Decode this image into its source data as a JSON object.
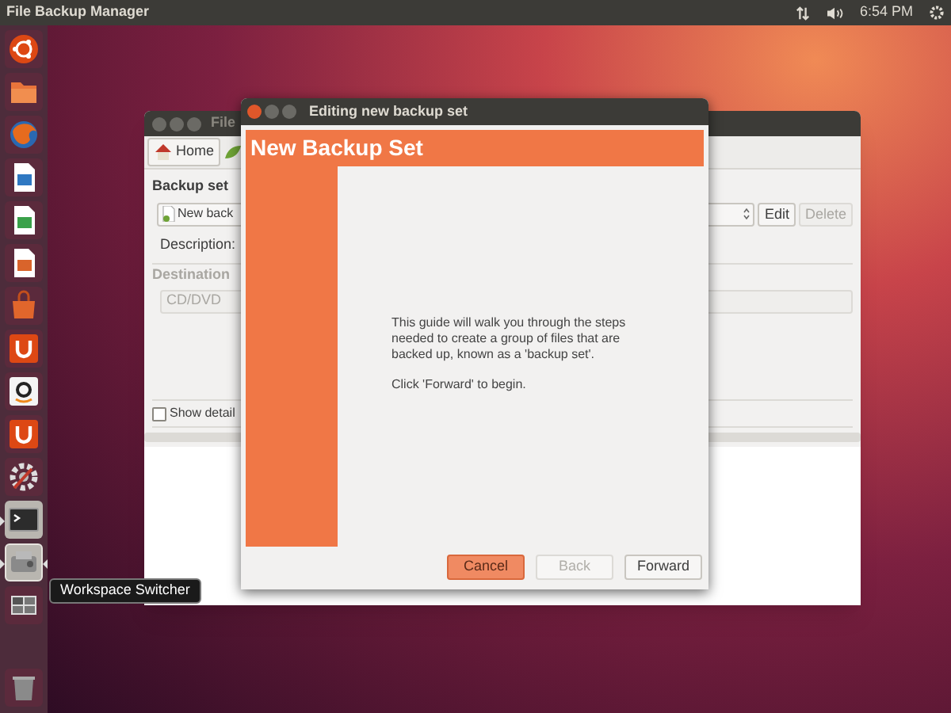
{
  "top_panel": {
    "app_title": "File Backup Manager",
    "clock": "6:54 PM"
  },
  "launcher": {
    "items": [
      {
        "kind": "ubuntu",
        "running": false,
        "focused": false
      },
      {
        "kind": "folder",
        "running": false,
        "focused": false
      },
      {
        "kind": "browser",
        "running": false,
        "focused": false
      },
      {
        "kind": "writer",
        "running": false,
        "focused": false
      },
      {
        "kind": "calc",
        "running": false,
        "focused": false
      },
      {
        "kind": "impress",
        "running": false,
        "focused": false
      },
      {
        "kind": "store",
        "running": false,
        "focused": false
      },
      {
        "kind": "cloud",
        "running": false,
        "focused": false
      },
      {
        "kind": "shop",
        "running": false,
        "focused": false
      },
      {
        "kind": "music",
        "running": false,
        "focused": false
      },
      {
        "kind": "settings",
        "running": false,
        "focused": false
      },
      {
        "kind": "terminal",
        "running": true,
        "focused": false
      },
      {
        "kind": "backup",
        "running": true,
        "focused": true
      },
      {
        "kind": "workspaces",
        "running": false,
        "focused": false
      }
    ],
    "trash": {
      "kind": "trash"
    },
    "tooltip": "Workspace Switcher"
  },
  "background_window": {
    "title": "File",
    "toolbar": [
      {
        "label": "Home"
      }
    ],
    "backup_set_label": "Backup set",
    "backup_set_value": "New back",
    "edit_button": {
      "label": "Edit",
      "disabled": false
    },
    "delete_button": {
      "label": "Delete",
      "disabled": true
    },
    "description_label": "Description:",
    "destination": {
      "label": "Destination",
      "value": "CD/DVD",
      "disabled": true
    },
    "show_details": {
      "label": "Show detail",
      "checked": false
    }
  },
  "dialog": {
    "title": "Editing new backup set",
    "heading": "New Backup Set",
    "paragraphs": [
      "This guide will walk you through the steps needed to create a group of files that are backed up, known as a 'backup set'.",
      "Click 'Forward' to begin."
    ],
    "buttons": [
      {
        "label": "Cancel",
        "kind": "suggested",
        "disabled": false
      },
      {
        "label": "Back",
        "kind": "normal",
        "disabled": true
      },
      {
        "label": "Forward",
        "kind": "normal",
        "disabled": false
      }
    ]
  }
}
